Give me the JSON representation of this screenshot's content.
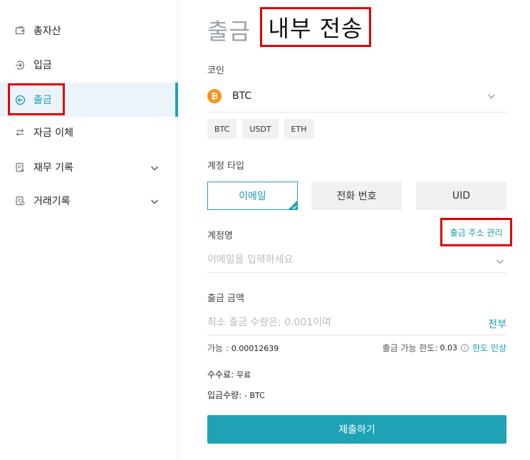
{
  "sidebar": {
    "items": [
      {
        "label": "총자산",
        "icon": "wallet-icon"
      },
      {
        "label": "입금",
        "icon": "deposit-icon"
      },
      {
        "label": "출금",
        "icon": "withdraw-icon",
        "active": true
      },
      {
        "label": "자금 이체",
        "icon": "transfer-icon"
      },
      {
        "label": "재무 기록",
        "icon": "document-icon",
        "expandable": true
      },
      {
        "label": "거래기록",
        "icon": "history-icon",
        "expandable": true
      }
    ]
  },
  "header": {
    "title": "출금",
    "subtitle": "내부 전송"
  },
  "coin": {
    "label": "코인",
    "selected": "BTC",
    "icon_letter": "₿",
    "icon_color": "#f7931a",
    "quick": [
      "BTC",
      "USDT",
      "ETH"
    ]
  },
  "account_type": {
    "label": "계정 타입",
    "tabs": [
      "이메일",
      "전화 번호",
      "UID"
    ],
    "selected_index": 0
  },
  "account_name": {
    "label": "계정명",
    "manage_link": "출금 주소 관리",
    "placeholder": "이메일을 입력하세요"
  },
  "amount": {
    "label": "출금 금액",
    "placeholder": "최소 출금 수량은: 0.001이며",
    "all_label": "전부"
  },
  "available": {
    "label": "가능 :",
    "value": "0.00012639",
    "limit_label": "출금 가능 한도:",
    "limit_value": "0.03",
    "increase_label": "한도 인상"
  },
  "fee": {
    "label": "수수료:",
    "value": "무료"
  },
  "received": {
    "label": "입금수량:",
    "value": "- BTC"
  },
  "submit_label": "제출하기",
  "colors": {
    "accent": "#1fa2b5",
    "annotation": "#e00000"
  }
}
